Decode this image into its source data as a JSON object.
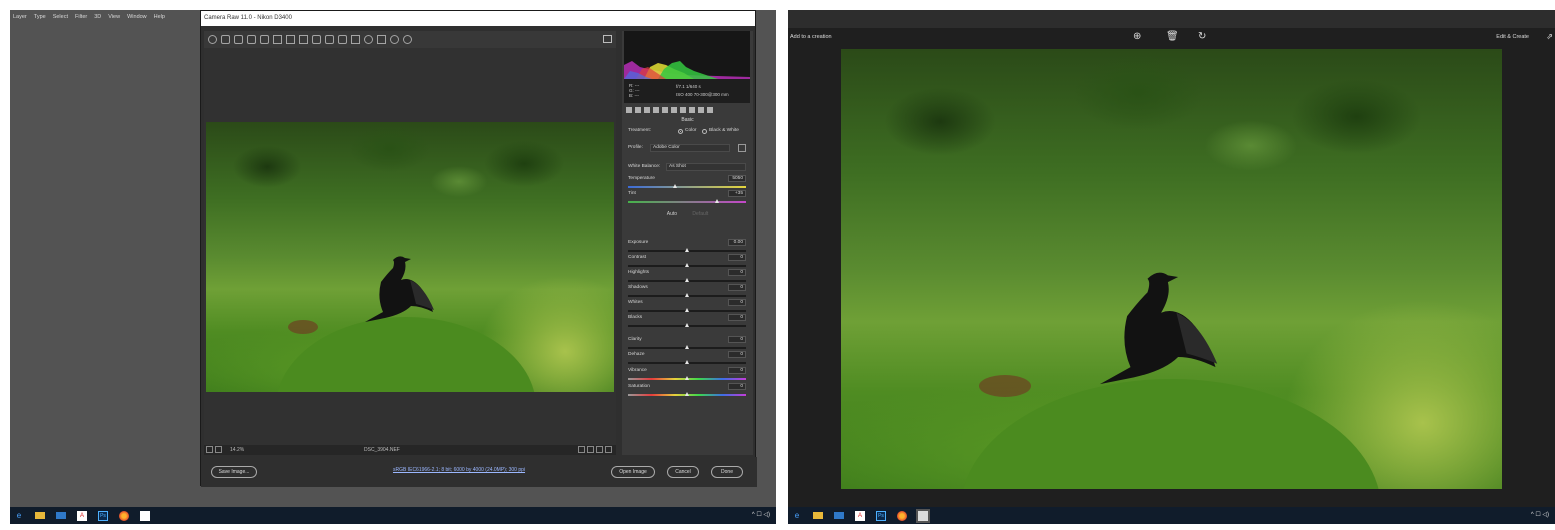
{
  "left": {
    "menubar": [
      "Layer",
      "Type",
      "Select",
      "Filter",
      "3D",
      "View",
      "Window",
      "Help"
    ],
    "dialog_title": "Camera Raw 11.0 - Nikon D3400",
    "histogram": {
      "rgb_lines": [
        "R:  ---",
        "G:  ---",
        "B:  ---"
      ],
      "exif_line1": "f/7.1   1/640 s",
      "exif_line2": "ISO 400   70-300@300 mm"
    },
    "panel_title": "Basic",
    "treatment": {
      "label": "Treatment:",
      "option_color": "Color",
      "option_bw": "Black & White"
    },
    "profile": {
      "label": "Profile:",
      "value": "Adobe Color"
    },
    "white_balance": {
      "label": "White Balance:",
      "value": "As Shot"
    },
    "temperature": {
      "label": "Temperature",
      "value": "5050",
      "level": 0.4
    },
    "tint": {
      "label": "Tint",
      "value": "+35",
      "level": 0.75
    },
    "auto_label": "Auto",
    "default_label": "Default",
    "sliders": [
      {
        "label": "Exposure",
        "value": "0.00",
        "level": 0.5
      },
      {
        "label": "Contrast",
        "value": "0",
        "level": 0.5
      },
      {
        "label": "Highlights",
        "value": "0",
        "level": 0.5
      },
      {
        "label": "Shadows",
        "value": "0",
        "level": 0.5
      },
      {
        "label": "Whites",
        "value": "0",
        "level": 0.5
      },
      {
        "label": "Blacks",
        "value": "0",
        "level": 0.5
      },
      {
        "label": "Clarity",
        "value": "0",
        "level": 0.5
      },
      {
        "label": "Dehaze",
        "value": "0",
        "level": 0.5
      },
      {
        "label": "Vibrance",
        "value": "0",
        "level": 0.5
      },
      {
        "label": "Saturation",
        "value": "0",
        "level": 0.5
      }
    ],
    "zoom": "14.2%",
    "file_name": "DSC_3904.NEF",
    "footer": {
      "save_label": "Save Image...",
      "workflow_link": "sRGB IEC61966-2.1; 8 bit; 6000 by 4000 (24.0MP); 300 ppi",
      "open_label": "Open Image",
      "cancel_label": "Cancel",
      "done_label": "Done"
    }
  },
  "right": {
    "add_to_creation": "Add to a creation",
    "edit_create": "Edit & Create"
  },
  "colors": {
    "ps_bg": "#535353",
    "dialog_bg": "#2f2f2f",
    "taskbar": "#101c2b",
    "viewer_bg": "#1f1f1f"
  }
}
